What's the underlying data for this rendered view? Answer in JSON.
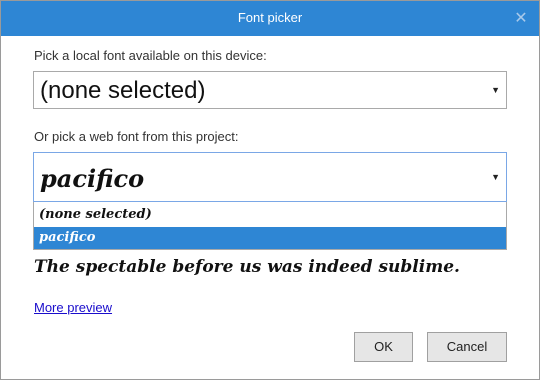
{
  "dialog": {
    "title": "Font picker",
    "close_glyph": "✕"
  },
  "local_font": {
    "label": "Pick a local font available on this device:",
    "selected": "(none selected)"
  },
  "web_font": {
    "label": "Or pick a web font from this project:",
    "selected": "pacifico",
    "options": [
      "(none selected)",
      "pacifico"
    ],
    "highlighted_option_index": 1
  },
  "preview": {
    "text": "The spectable before us was indeed sublime.",
    "more_link": "More preview"
  },
  "buttons": {
    "ok": "OK",
    "cancel": "Cancel"
  },
  "colors": {
    "titlebar": "#2e86d4",
    "selection": "#2e86d4",
    "link": "#1a0dcc"
  },
  "icons": {
    "close": "close-icon",
    "dropdown_arrow": "dropdown-arrow-icon"
  }
}
